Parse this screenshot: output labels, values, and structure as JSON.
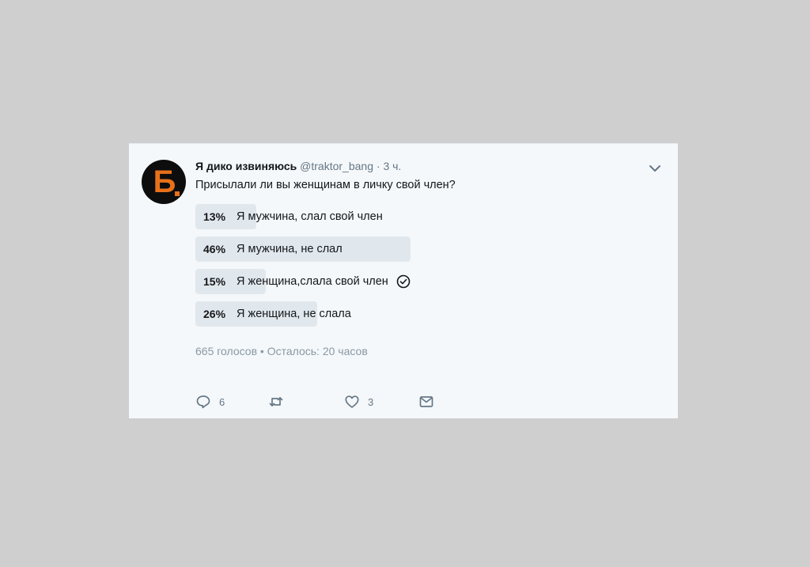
{
  "tweet": {
    "display_name": "Я дико извиняюсь",
    "handle": "@traktor_bang",
    "separator": "·",
    "time": "3 ч.",
    "text": "Присылали ли вы женщинам в личку свой член?",
    "avatar_letter": "Б",
    "avatar_color": "#e8701a"
  },
  "poll": {
    "options": [
      {
        "percent": "13%",
        "label": "Я мужчина, слал свой член",
        "fraction": 0.13
      },
      {
        "percent": "46%",
        "label": "Я мужчина, не слал",
        "fraction": 0.46
      },
      {
        "percent": "15%",
        "label": "Я женщина,слала свой член",
        "fraction": 0.15,
        "selected": true
      },
      {
        "percent": "26%",
        "label": "Я женщина, не слала",
        "fraction": 0.26
      }
    ],
    "votes": "665 голосов",
    "bullet": "•",
    "remaining": "Осталось: 20 часов"
  },
  "actions": {
    "reply_count": "6",
    "retweet_count": "",
    "like_count": "3",
    "icons": [
      "reply-icon",
      "retweet-icon",
      "like-icon",
      "message-icon"
    ]
  },
  "colors": {
    "bar": "#e1e8ed",
    "card": "#f5f8fa",
    "muted": "#657786"
  }
}
